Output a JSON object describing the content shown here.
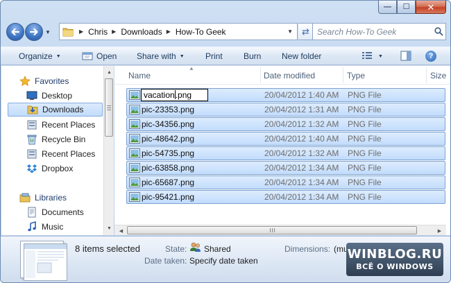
{
  "window": {
    "minimize_glyph": "—",
    "maximize_glyph": "☐",
    "close_glyph": "✕"
  },
  "address": {
    "crumbs": [
      "Chris",
      "Downloads",
      "How-To Geek"
    ],
    "search_placeholder": "Search How-To Geek"
  },
  "toolbar": {
    "organize": "Organize",
    "open": "Open",
    "share_with": "Share with",
    "print": "Print",
    "burn": "Burn",
    "new_folder": "New folder",
    "help": "?"
  },
  "navpane": {
    "favorites": "Favorites",
    "desktop": "Desktop",
    "downloads": "Downloads",
    "recent_places_1": "Recent Places",
    "recycle_bin": "Recycle Bin",
    "recent_places_2": "Recent Places",
    "dropbox": "Dropbox",
    "libraries": "Libraries",
    "documents": "Documents",
    "music": "Music"
  },
  "columns": {
    "name": "Name",
    "date_modified": "Date modified",
    "type": "Type",
    "size": "Size"
  },
  "files": [
    {
      "name": "vacation.png",
      "date": "20/04/2012 1:40 AM",
      "type": "PNG File"
    },
    {
      "name": "pic-23353.png",
      "date": "20/04/2012 1:31 AM",
      "type": "PNG File"
    },
    {
      "name": "pic-34356.png",
      "date": "20/04/2012 1:32 AM",
      "type": "PNG File"
    },
    {
      "name": "pic-48642.png",
      "date": "20/04/2012 1:40 AM",
      "type": "PNG File"
    },
    {
      "name": "pic-54735.png",
      "date": "20/04/2012 1:32 AM",
      "type": "PNG File"
    },
    {
      "name": "pic-63858.png",
      "date": "20/04/2012 1:34 AM",
      "type": "PNG File"
    },
    {
      "name": "pic-65687.png",
      "date": "20/04/2012 1:34 AM",
      "type": "PNG File"
    },
    {
      "name": "pic-95421.png",
      "date": "20/04/2012 1:34 AM",
      "type": "PNG File"
    }
  ],
  "rename": {
    "before_caret": "vacation",
    "after_caret": ".png"
  },
  "details": {
    "selection_count": "8 items selected",
    "state_label": "State:",
    "state_value": "Shared",
    "date_taken_label": "Date taken:",
    "date_taken_value": "Specify date taken",
    "dimensions_label": "Dimensions:",
    "dimensions_value": "(multiple values)"
  },
  "watermark": {
    "line1": "WINBLOG.RU",
    "line2": "ВСЁ О WINDOWS"
  },
  "colors": {
    "selection_fill": "#c2dcfd",
    "selection_border": "#7da2ce",
    "toolbar_text": "#1e395b"
  }
}
